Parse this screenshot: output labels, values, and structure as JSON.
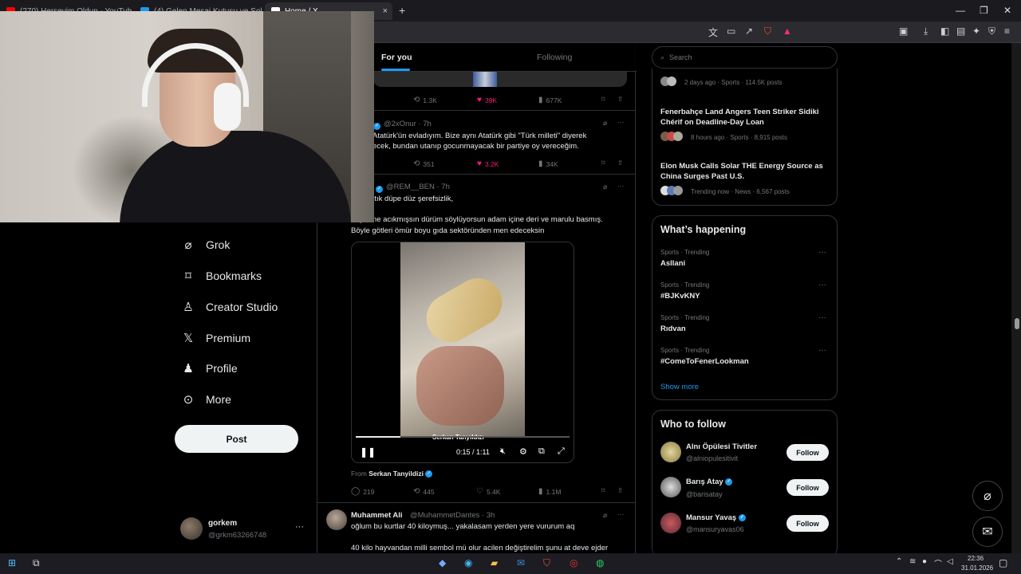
{
  "browser": {
    "tabs": [
      {
        "title": "(270) Herşeyim Oldun - YouTube",
        "favicon_color": "#ff0000"
      },
      {
        "title": "(4) Gelen Mesaj Kutusu ve Sohbet",
        "favicon_color": "#1d9bf0"
      },
      {
        "title": "Home / X",
        "favicon_color": "#ffffff"
      }
    ],
    "new_tab": "+",
    "close_tab": "×"
  },
  "nav": {
    "items": [
      {
        "label": "Grok",
        "icon": "grok-icon"
      },
      {
        "label": "Bookmarks",
        "icon": "bookmark-icon"
      },
      {
        "label": "Creator Studio",
        "icon": "creator-studio-icon"
      },
      {
        "label": "Premium",
        "icon": "x-logo-icon"
      },
      {
        "label": "Profile",
        "icon": "person-icon"
      },
      {
        "label": "More",
        "icon": "more-circle-icon"
      }
    ],
    "post_label": "Post",
    "account": {
      "name": "gorkem",
      "handle": "@grkm63266748",
      "more": "···"
    }
  },
  "feed": {
    "tabs": {
      "for_you": "For you",
      "following": "Following"
    },
    "tweet1_metrics": {
      "reposts": "1.3K",
      "likes": "39K",
      "views": "677K"
    },
    "tweet2": {
      "handle": "@2xOnur · 7h",
      "line1": "Atatürk'ün evladıyım. Bize aynı Atatürk gibi \"Türk milleti\" diyerek",
      "line2": "ecek, bundan utanıp gocunmayacak bir partiye oy vereceğim.",
      "reposts": "351",
      "likes": "3.2K",
      "views": "34K"
    },
    "tweet3": {
      "handle": "@REM__BEN · 7h",
      "line1": "u artık düpe düz şerefsizlik,",
      "line2": "…ş sene acıkmışsın dürüm söylüyorsun adam içine deri ve marulu basmış.",
      "line3": "Böyle götleri ömür boyu gıda sektöründen men edeceksin",
      "video": {
        "watermark": "Serkan Tanyıldızı",
        "time": "0:15 / 1:11",
        "progress": 0.21
      },
      "from_label": "From",
      "from_name": "Serkan Tanyildizi",
      "replies": "219",
      "reposts": "445",
      "likes": "5.4K",
      "views": "1.1M"
    },
    "tweet4": {
      "name": "Muhammet Ali",
      "handle": "@MuhammetDantes · 3h",
      "line1": "oğlum bu kurtlar 40 kiloymuş... yakalasam yerden yere vururum aq",
      "line2": "40 kilo hayvandan milli sembol mü olur acilen değiştirelim şunu at deve ejder"
    }
  },
  "right": {
    "search_placeholder": "Search",
    "trending_top": [
      {
        "meta": "2 days ago · Sports · 114.5K posts"
      },
      {
        "title": "Fenerbahçe Land Angers Teen Striker Sidiki Chérif on Deadline-Day Loan",
        "meta": "8 hours ago · Sports · 8,915 posts"
      },
      {
        "title": "Elon Musk Calls Solar THE Energy Source as China Surges Past U.S.",
        "meta": "Trending now · News · 6,567 posts"
      }
    ],
    "whats_happening": {
      "title": "What’s happening",
      "items": [
        {
          "meta": "Sports · Trending",
          "name": "Asllani"
        },
        {
          "meta": "Sports · Trending",
          "name": "#BJKvKNY"
        },
        {
          "meta": "Sports · Trending",
          "name": "Rıdvan"
        },
        {
          "meta": "Sports · Trending",
          "name": "#ComeToFenerLookman"
        }
      ],
      "show_more": "Show more"
    },
    "who_to_follow": {
      "title": "Who to follow",
      "users": [
        {
          "name": "Alnı Öpülesi Tivitler",
          "handle": "@alniopulesitivit",
          "verified": false
        },
        {
          "name": "Barış Atay",
          "handle": "@barisatay",
          "verified": true
        },
        {
          "name": "Mansur Yavaş",
          "handle": "@mansuryavas06",
          "verified": true
        }
      ],
      "follow_label": "Follow"
    }
  },
  "taskbar": {
    "time": "22:36",
    "date": "31.01.2026"
  },
  "colors": {
    "accent": "#1d9bf0",
    "like": "#f91880",
    "background": "#000000"
  }
}
